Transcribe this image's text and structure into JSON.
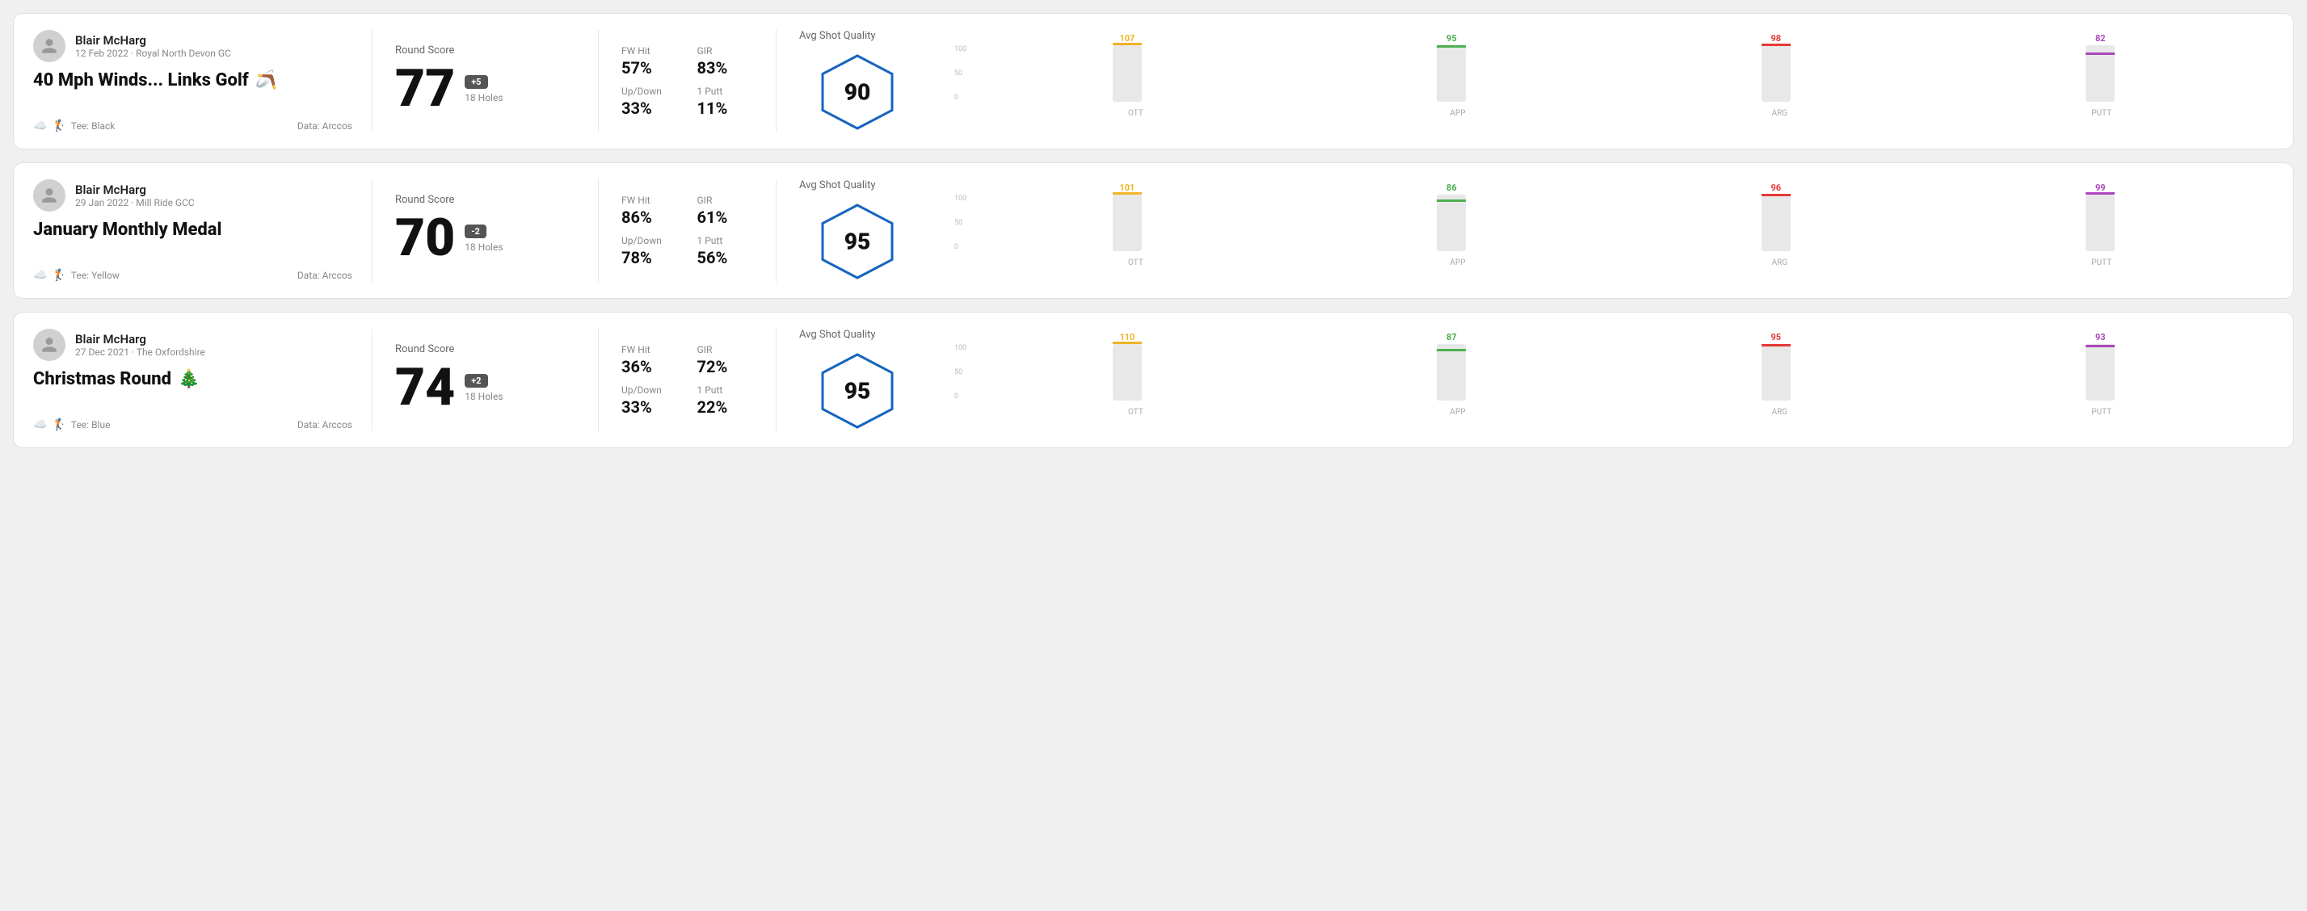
{
  "rounds": [
    {
      "id": "round1",
      "player_name": "Blair McHarg",
      "date": "12 Feb 2022 · Royal North Devon GC",
      "title": "40 Mph Winds... Links Golf",
      "title_emoji": "🪃",
      "tee": "Tee: Black",
      "data_source": "Data: Arccos",
      "round_score_label": "Round Score",
      "score": "77",
      "score_diff": "+5",
      "holes": "18 Holes",
      "fw_hit_label": "FW Hit",
      "fw_hit_value": "57%",
      "gir_label": "GIR",
      "gir_value": "83%",
      "updown_label": "Up/Down",
      "updown_value": "33%",
      "oneputt_label": "1 Putt",
      "oneputt_value": "11%",
      "avg_quality_label": "Avg Shot Quality",
      "quality_score": "90",
      "chart": {
        "bars": [
          {
            "label": "OTT",
            "value": 107,
            "color": "#f0b429"
          },
          {
            "label": "APP",
            "value": 95,
            "color": "#4caf50"
          },
          {
            "label": "ARG",
            "value": 98,
            "color": "#e53935"
          },
          {
            "label": "PUTT",
            "value": 82,
            "color": "#ab47bc"
          }
        ],
        "y_max": 100
      }
    },
    {
      "id": "round2",
      "player_name": "Blair McHarg",
      "date": "29 Jan 2022 · Mill Ride GCC",
      "title": "January Monthly Medal",
      "title_emoji": "",
      "tee": "Tee: Yellow",
      "data_source": "Data: Arccos",
      "round_score_label": "Round Score",
      "score": "70",
      "score_diff": "-2",
      "holes": "18 Holes",
      "fw_hit_label": "FW Hit",
      "fw_hit_value": "86%",
      "gir_label": "GIR",
      "gir_value": "61%",
      "updown_label": "Up/Down",
      "updown_value": "78%",
      "oneputt_label": "1 Putt",
      "oneputt_value": "56%",
      "avg_quality_label": "Avg Shot Quality",
      "quality_score": "95",
      "chart": {
        "bars": [
          {
            "label": "OTT",
            "value": 101,
            "color": "#f0b429"
          },
          {
            "label": "APP",
            "value": 86,
            "color": "#4caf50"
          },
          {
            "label": "ARG",
            "value": 96,
            "color": "#e53935"
          },
          {
            "label": "PUTT",
            "value": 99,
            "color": "#ab47bc"
          }
        ],
        "y_max": 100
      }
    },
    {
      "id": "round3",
      "player_name": "Blair McHarg",
      "date": "27 Dec 2021 · The Oxfordshire",
      "title": "Christmas Round",
      "title_emoji": "🎄",
      "tee": "Tee: Blue",
      "data_source": "Data: Arccos",
      "round_score_label": "Round Score",
      "score": "74",
      "score_diff": "+2",
      "holes": "18 Holes",
      "fw_hit_label": "FW Hit",
      "fw_hit_value": "36%",
      "gir_label": "GIR",
      "gir_value": "72%",
      "updown_label": "Up/Down",
      "updown_value": "33%",
      "oneputt_label": "1 Putt",
      "oneputt_value": "22%",
      "avg_quality_label": "Avg Shot Quality",
      "quality_score": "95",
      "chart": {
        "bars": [
          {
            "label": "OTT",
            "value": 110,
            "color": "#f0b429"
          },
          {
            "label": "APP",
            "value": 87,
            "color": "#4caf50"
          },
          {
            "label": "ARG",
            "value": 95,
            "color": "#e53935"
          },
          {
            "label": "PUTT",
            "value": 93,
            "color": "#ab47bc"
          }
        ],
        "y_max": 100
      }
    }
  ]
}
